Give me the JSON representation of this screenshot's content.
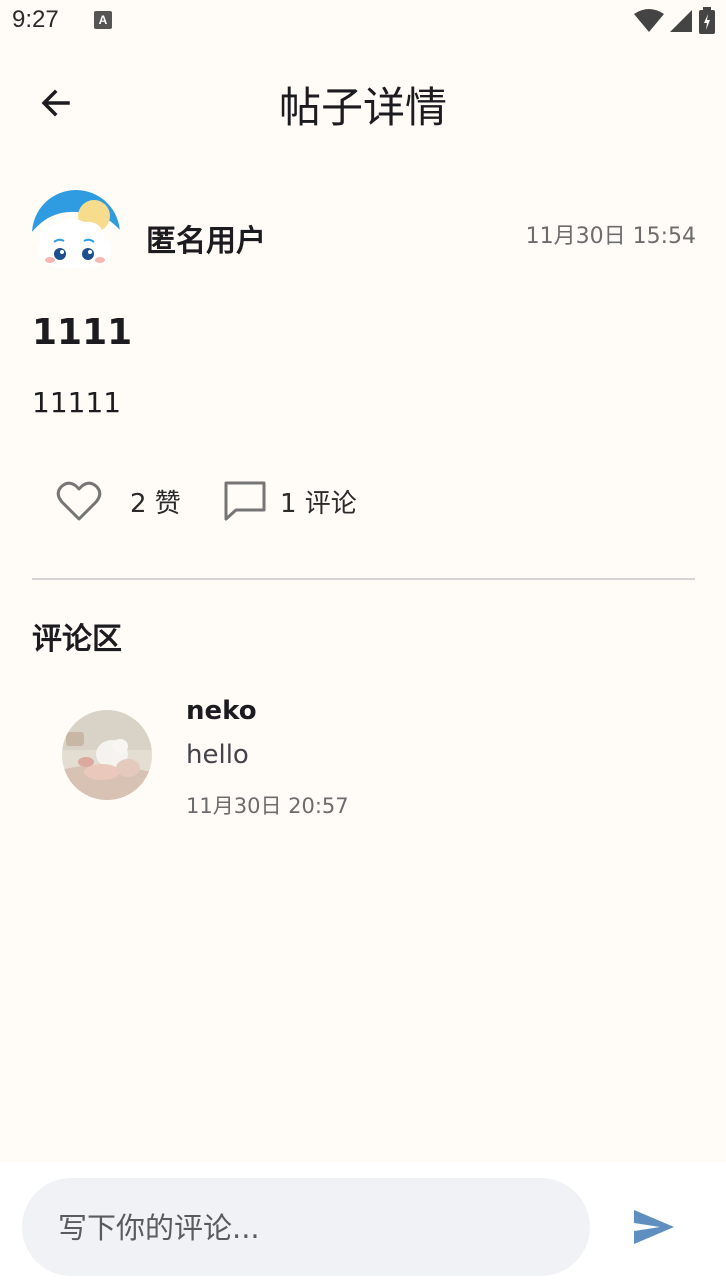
{
  "status_bar": {
    "time": "9:27",
    "notification_icon": "A"
  },
  "header": {
    "title": "帖子详情",
    "back_icon": "arrow-back-icon"
  },
  "post": {
    "author": "匿名用户",
    "time": "11月30日 15:54",
    "title": "1111",
    "content": "11111",
    "like_count": "2 赞",
    "comment_count": "1 评论"
  },
  "comments_section": {
    "title": "评论区",
    "items": [
      {
        "author": "neko",
        "text": "hello",
        "time": "11月30日 20:57"
      }
    ]
  },
  "comment_input": {
    "placeholder": "写下你的评论...",
    "value": ""
  },
  "colors": {
    "background": "#fffcf8",
    "send_accent": "#5f8fc0",
    "divider": "#d6d4d6",
    "input_bg": "#f1f2f5"
  }
}
